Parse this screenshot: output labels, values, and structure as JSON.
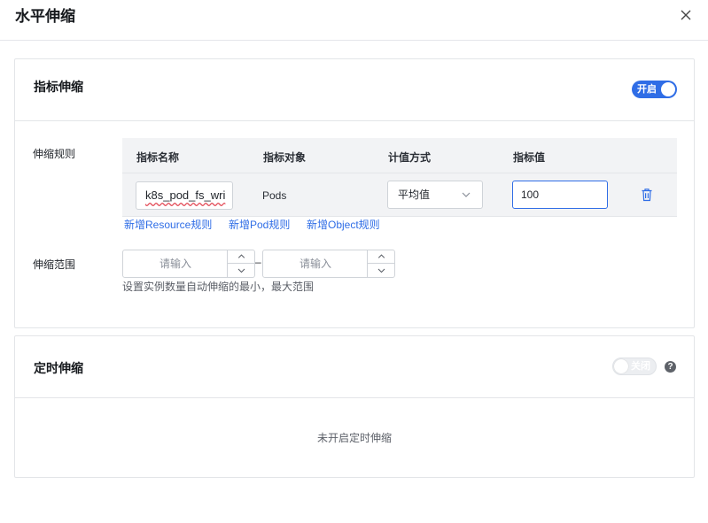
{
  "dialog": {
    "title": "水平伸缩",
    "close_icon": "close-icon"
  },
  "metric_scaling": {
    "title": "指标伸缩",
    "toggle_label": "开启",
    "toggle_state": "on",
    "rules_label": "伸缩规则",
    "columns": [
      "指标名称",
      "指标对象",
      "计值方式",
      "指标值"
    ],
    "row": {
      "metric_name": "k8s_pod_fs_wri",
      "target": "Pods",
      "calc_method": "平均值",
      "metric_value": "100"
    },
    "add_links": [
      "新增Resource规则",
      "新增Pod规则",
      "新增Object规则"
    ],
    "range_label": "伸缩范围",
    "min_placeholder": "请输入",
    "max_placeholder": "请输入",
    "range_separator": "–",
    "hint": "设置实例数量自动伸缩的最小，最大范围"
  },
  "scheduled_scaling": {
    "title": "定时伸缩",
    "toggle_label": "关闭",
    "toggle_state": "off",
    "help_icon": "?",
    "empty_text": "未开启定时伸缩"
  },
  "colors": {
    "accent": "#2f6de6",
    "border": "#e3e5e8",
    "table_bg": "#f2f3f5"
  }
}
